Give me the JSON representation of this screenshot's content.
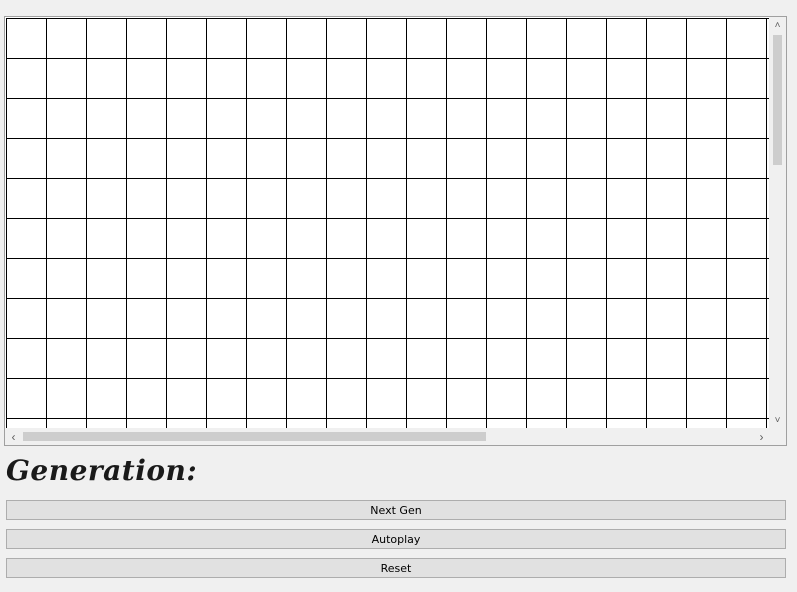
{
  "generation": {
    "label": "Generation:"
  },
  "buttons": {
    "next_gen": "Next Gen",
    "autoplay": "Autoplay",
    "reset": "Reset"
  },
  "icons": {
    "scroll_up": "chevron-up-icon",
    "scroll_down": "chevron-down-icon",
    "scroll_left": "chevron-left-icon",
    "scroll_right": "chevron-right-icon"
  },
  "colors": {
    "window_bg": "#f0f0f0",
    "grid_line": "#000000",
    "cell_bg": "#ffffff",
    "button_bg": "#e1e1e1"
  }
}
